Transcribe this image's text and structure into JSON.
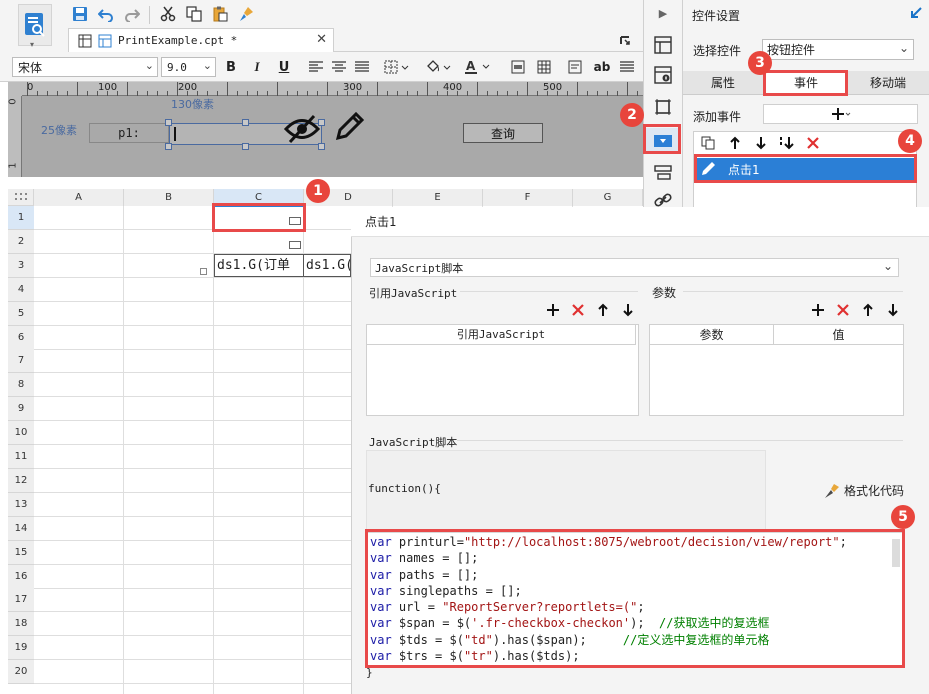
{
  "toolbar": {
    "tab_title": "PrintExample.cpt *",
    "font_name": "宋体",
    "font_size": "9.0",
    "bold": "B",
    "italic": "I",
    "underline": "U",
    "ab": "ab"
  },
  "ruler": {
    "marks": [
      "0",
      "100",
      "200",
      "300",
      "400",
      "500"
    ],
    "v_marks": [
      "0",
      "1"
    ],
    "width_label": "130像素",
    "height_label": "25像素"
  },
  "designer": {
    "param_label": "p1:",
    "query_button": "查询"
  },
  "grid": {
    "columns": [
      "A",
      "B",
      "C",
      "D",
      "E",
      "F",
      "G"
    ],
    "rows": [
      "1",
      "2",
      "3",
      "4",
      "5",
      "6",
      "7",
      "8",
      "9",
      "10",
      "11",
      "12",
      "13",
      "14",
      "15",
      "16",
      "17",
      "18",
      "19",
      "20"
    ],
    "cell_c3": "ds1.G(订单",
    "cell_d3": "ds1.G("
  },
  "right_panel": {
    "title": "控件设置",
    "select_control_label": "选择控件",
    "select_control_value": "按钮控件",
    "tabs": [
      "属性",
      "事件",
      "移动端"
    ],
    "add_event_label": "添加事件",
    "event_item": "点击1"
  },
  "event_dialog": {
    "title": "点击1",
    "script_type": "JavaScript脚本",
    "ref_js_section": "引用JavaScript",
    "ref_js_column": "引用JavaScript",
    "params_section": "参数",
    "params_column": "参数",
    "value_column": "值",
    "js_section": "JavaScript脚本",
    "function_header": "function(){",
    "format_code": "格式化代码",
    "closing_brace": "}"
  },
  "code": [
    [
      [
        "kw",
        "var"
      ],
      [
        "t",
        " printurl="
      ],
      [
        "str",
        "\"http://localhost:8075/webroot/decision/view/report\""
      ],
      [
        "t",
        ";"
      ]
    ],
    [
      [
        "kw",
        "var"
      ],
      [
        "t",
        " names = [];"
      ]
    ],
    [
      [
        "kw",
        "var"
      ],
      [
        "t",
        " paths = [];"
      ]
    ],
    [
      [
        "kw",
        "var"
      ],
      [
        "t",
        " singlepaths = [];"
      ]
    ],
    [
      [
        "kw",
        "var"
      ],
      [
        "t",
        " url = "
      ],
      [
        "str",
        "\"ReportServer?reportlets=(\""
      ],
      [
        "t",
        ";"
      ]
    ],
    [
      [
        "kw",
        "var"
      ],
      [
        "t",
        " $span = $("
      ],
      [
        "str",
        "'.fr-checkbox-checkon'"
      ],
      [
        "t",
        ");  "
      ],
      [
        "cm",
        "//获取选中的复选框"
      ]
    ],
    [
      [
        "kw",
        "var"
      ],
      [
        "t",
        " $tds = $("
      ],
      [
        "str",
        "\"td\""
      ],
      [
        "t",
        ").has($span);     "
      ],
      [
        "cm",
        "//定义选中复选框的单元格"
      ]
    ],
    [
      [
        "kw",
        "var"
      ],
      [
        "t",
        " $trs = $("
      ],
      [
        "str",
        "\"tr\""
      ],
      [
        "t",
        ").has($tds);"
      ]
    ]
  ],
  "badges": [
    "1",
    "2",
    "3",
    "4",
    "5"
  ],
  "colors": {
    "accent_blue": "#1a73c8",
    "highlight_red": "#e84a4a",
    "selected_row": "#2b7fd6"
  }
}
